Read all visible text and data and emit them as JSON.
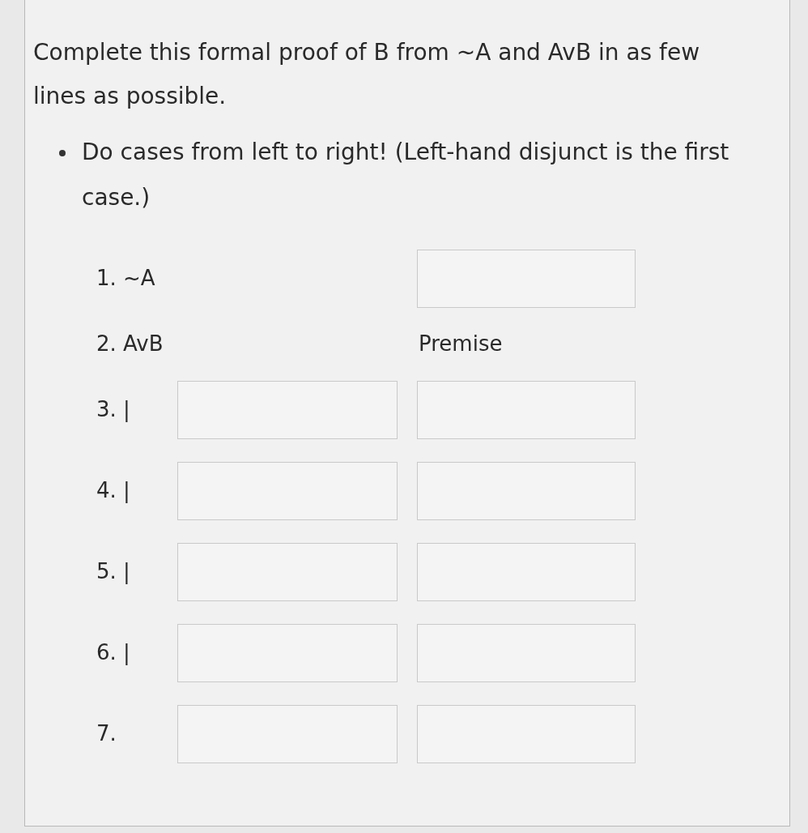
{
  "question": "Complete this formal proof of B from ~A and AvB in as few lines as possible.",
  "instructions": [
    "Do cases from left to right! (Left-hand disjunct is the first case.)"
  ],
  "lines": [
    {
      "kind": "given",
      "label": "1. ~A"
    },
    {
      "kind": "premise",
      "label": "2. AvB",
      "justification": "Premise"
    },
    {
      "kind": "entry",
      "label": "3. |"
    },
    {
      "kind": "entry",
      "label": "4. |"
    },
    {
      "kind": "entry",
      "label": "5. |"
    },
    {
      "kind": "entry",
      "label": "6. |"
    },
    {
      "kind": "entry",
      "label": "7."
    }
  ]
}
